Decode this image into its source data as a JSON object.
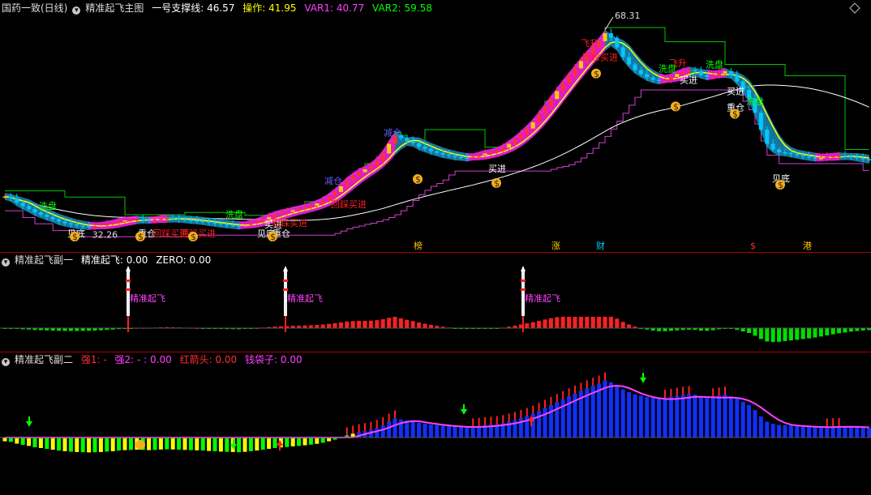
{
  "main_header": {
    "stock": "国药一致(日线)",
    "indicator": "精准起飞主图",
    "support_label": "一号支撑线",
    "support_value": "46.57",
    "op_label": "操作",
    "op_value": "41.95",
    "var1_label": "VAR1",
    "var1_value": "40.77",
    "var2_label": "VAR2",
    "var2_value": "59.58"
  },
  "sub1_header": {
    "title": "精准起飞副一",
    "a_label": "精准起飞",
    "a_value": "0.00",
    "b_label": "ZERO",
    "b_value": "0.00"
  },
  "sub2_header": {
    "title": "精准起飞副二",
    "a_label": "强1",
    "a_value": "-",
    "b_label": "强2",
    "b_value": "- : 0.00",
    "c_label": "红箭头",
    "c_value": "0.00",
    "d_label": "钱袋子",
    "d_value": "0.00"
  },
  "price_labels": {
    "high": "68.31",
    "low": "32.26"
  },
  "main_signals": [
    {
      "t": "洗盘",
      "c": "#00ff00",
      "i": 58
    },
    {
      "t": "见底",
      "c": "#ffffff",
      "i": 93
    },
    {
      "t": "重仓",
      "c": "#ffffff",
      "i": 180
    },
    {
      "t": "洗盘",
      "c": "#00ff00",
      "i": 288
    },
    {
      "t": "见底",
      "c": "#ffffff",
      "i": 327
    },
    {
      "t": "重仓",
      "c": "#ffffff",
      "i": 346
    },
    {
      "t": "买进",
      "c": "#ffffff",
      "i": 336
    },
    {
      "t": "回踩买进",
      "c": "#ff2020",
      "i": 198
    },
    {
      "t": "回踩买进",
      "c": "#ff2020",
      "i": 232
    },
    {
      "t": "回踩买进",
      "c": "#ff2020",
      "i": 345
    },
    {
      "t": "回踩买进",
      "c": "#ff2020",
      "i": 418
    },
    {
      "t": "减仓",
      "c": "#6060ff",
      "i": 410
    },
    {
      "t": "减仓",
      "c": "#6060ff",
      "i": 483
    },
    {
      "t": "买进",
      "c": "#ffffff",
      "i": 612
    },
    {
      "t": "飞升",
      "c": "#ff2020",
      "i": 726
    },
    {
      "t": "回踩买进",
      "c": "#ff2020",
      "i": 728
    },
    {
      "t": "洗盘",
      "c": "#00ff00",
      "i": 822
    },
    {
      "t": "洗盘",
      "c": "#00ff00",
      "i": 880
    },
    {
      "t": "买进",
      "c": "#ffffff",
      "i": 848
    },
    {
      "t": "飞升",
      "c": "#ff2020",
      "i": 835
    },
    {
      "t": "重仓",
      "c": "#ffffff",
      "i": 906
    },
    {
      "t": "买进",
      "c": "#ffffff",
      "i": 906
    },
    {
      "t": "洗盘",
      "c": "#00ff00",
      "i": 930
    },
    {
      "t": "见底",
      "c": "#ffffff",
      "i": 962
    }
  ],
  "news_markers": [
    {
      "t": "榜",
      "c": "#ffcc00",
      "i": 510
    },
    {
      "t": "涨",
      "c": "#ffcc00",
      "i": 680
    },
    {
      "t": "财",
      "c": "#00ccff",
      "i": 735
    },
    {
      "t": "$",
      "c": "#ff3030",
      "i": 925
    },
    {
      "t": "港",
      "c": "#ffcc00",
      "i": 990
    }
  ],
  "takeoff_labels": [
    {
      "t": "精准起飞",
      "i": 158
    },
    {
      "t": "精准起飞",
      "i": 352
    },
    {
      "t": "精准起飞",
      "i": 645
    }
  ],
  "chart_data": {
    "type": "candlestick",
    "close": [
      38.2,
      37.9,
      37.1,
      36.5,
      36.0,
      35.4,
      35.0,
      34.6,
      34.2,
      33.8,
      33.5,
      33.3,
      33.1,
      33.0,
      32.9,
      33.0,
      33.1,
      33.3,
      33.5,
      33.8,
      34.0,
      34.1,
      34.2,
      34.1,
      34.0,
      34.1,
      34.3,
      34.4,
      34.3,
      34.2,
      34.1,
      34.0,
      33.9,
      33.8,
      33.6,
      33.5,
      33.3,
      33.2,
      33.1,
      33.0,
      33.2,
      33.5,
      33.8,
      34.2,
      34.6,
      35.0,
      35.3,
      35.5,
      35.8,
      36.0,
      36.3,
      36.6,
      37.0,
      37.5,
      38.2,
      39.0,
      40.0,
      41.0,
      41.8,
      42.5,
      43.0,
      43.6,
      44.5,
      45.8,
      47.5,
      49.0,
      48.5,
      48.0,
      47.6,
      47.0,
      46.6,
      46.2,
      45.9,
      45.6,
      45.4,
      45.2,
      45.1,
      45.0,
      45.2,
      45.5,
      45.8,
      46.0,
      46.3,
      46.8,
      47.5,
      48.3,
      49.2,
      50.2,
      51.3,
      52.6,
      54.0,
      55.4,
      56.8,
      58.2,
      59.5,
      60.8,
      62.1,
      63.3,
      64.5,
      65.6,
      67.0,
      66.2,
      64.5,
      62.8,
      61.5,
      60.5,
      59.8,
      59.2,
      58.8,
      58.6,
      58.8,
      59.3,
      59.8,
      60.2,
      60.5,
      60.3,
      59.6,
      59.3,
      59.5,
      59.9,
      60.3,
      59.6,
      58.5,
      57.0,
      55.5,
      53.0,
      50.0,
      47.5,
      46.5,
      46.0,
      45.9,
      45.7,
      45.5,
      45.3,
      45.1,
      45.0,
      45.0,
      45.2,
      45.3,
      45.4,
      45.3,
      45.2,
      45.0,
      44.8,
      44.6
    ]
  }
}
